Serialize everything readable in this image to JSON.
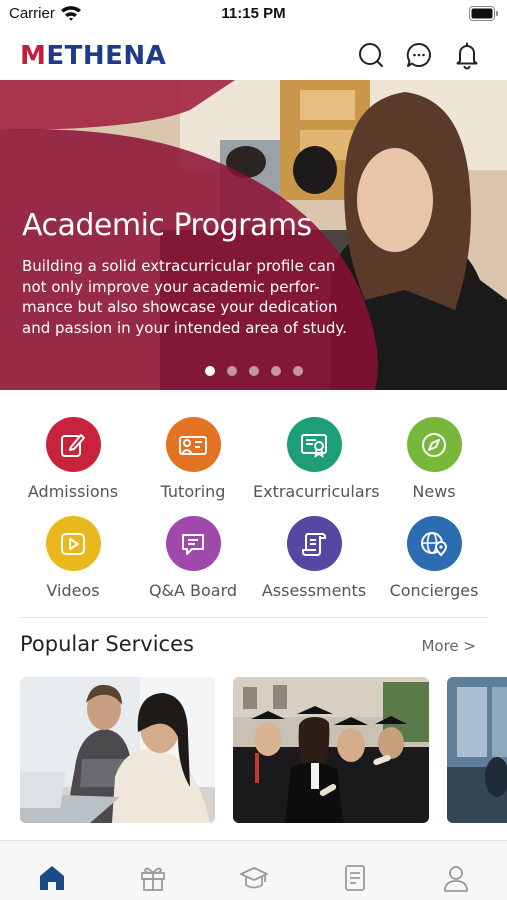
{
  "status_bar": {
    "carrier": "Carrier",
    "time": "11:15 PM"
  },
  "header": {
    "logo": "METHENA"
  },
  "hero": {
    "title": "Academic Programs",
    "description": "Building a solid extracurricular profile can not only improve your academic perfor- mance but also showcase your dedication and passion in your intended area of study.",
    "slide_count": 5,
    "active_slide": 1
  },
  "categories": [
    {
      "label": "Admissions",
      "icon": "edit-icon",
      "color": "#c8233c"
    },
    {
      "label": "Tutoring",
      "icon": "tutor-icon",
      "color": "#e37222"
    },
    {
      "label": "Extracurriculars",
      "icon": "certificate-icon",
      "color": "#1e9e77"
    },
    {
      "label": "News",
      "icon": "compass-icon",
      "color": "#77b83a"
    },
    {
      "label": "Videos",
      "icon": "play-icon",
      "color": "#e9b81c"
    },
    {
      "label": "Q&A Board",
      "icon": "message-icon",
      "color": "#a048ab"
    },
    {
      "label": "Assessments",
      "icon": "scroll-icon",
      "color": "#5548a3"
    },
    {
      "label": "Concierges",
      "icon": "globe-pin-icon",
      "color": "#2c6cb2"
    }
  ],
  "popular_services": {
    "title": "Popular Services",
    "more": "More >"
  },
  "colors": {
    "brand": "#1f3a8a",
    "accent": "#c41e3a",
    "tab_active": "#1c4a87",
    "tab_inactive": "#9a9a9a"
  },
  "tabs": [
    {
      "name": "home",
      "icon": "home-icon",
      "active": true
    },
    {
      "name": "gifts",
      "icon": "gift-icon",
      "active": false
    },
    {
      "name": "courses",
      "icon": "graduation-cap-icon",
      "active": false
    },
    {
      "name": "notes",
      "icon": "notebook-icon",
      "active": false
    },
    {
      "name": "profile",
      "icon": "user-icon",
      "active": false
    }
  ]
}
